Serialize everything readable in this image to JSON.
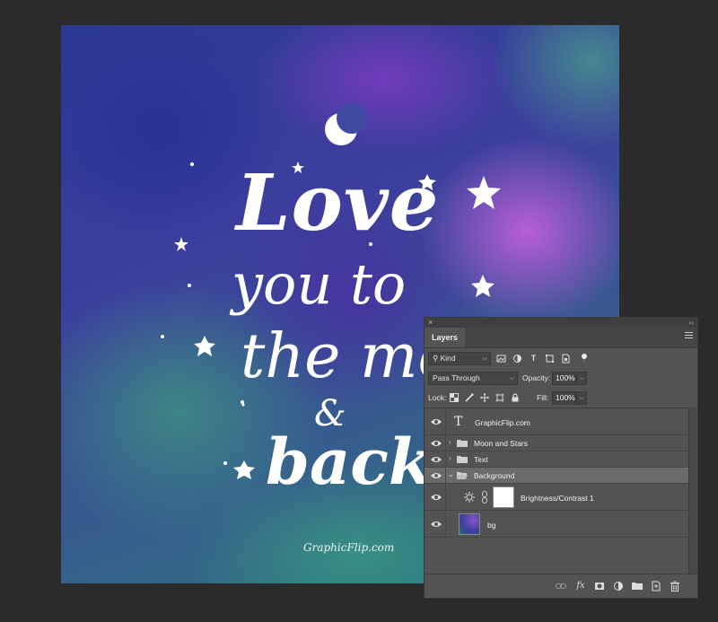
{
  "artwork": {
    "line1": "Love",
    "line2": "you to",
    "line3": "the moo",
    "line4": "&",
    "line5": "back",
    "signature": "GraphicFlip.com"
  },
  "panel": {
    "close_glyph": "×",
    "collapse_glyph": "‹‹",
    "tab_label": "Layers",
    "filter": {
      "kind_label": "Kind",
      "filter_icons": [
        "image-filter-icon",
        "adjustment-filter-icon",
        "type-filter-icon",
        "shape-filter-icon",
        "smart-object-filter-icon"
      ]
    },
    "blend_mode": "Pass Through",
    "opacity_label": "Opacity:",
    "opacity_value": "100%",
    "lock_label": "Lock:",
    "fill_label": "Fill:",
    "fill_value": "100%",
    "layers": [
      {
        "name": "GraphicFlip.com",
        "kind": "text"
      },
      {
        "name": "Moon and Stars",
        "kind": "group"
      },
      {
        "name": "Text",
        "kind": "group"
      },
      {
        "name": "Background",
        "kind": "group-open",
        "selected": true
      },
      {
        "name": "Brightness/Contrast 1",
        "kind": "adjustment"
      },
      {
        "name": "bg",
        "kind": "image"
      }
    ],
    "bottom_icons": [
      "link-layers-icon",
      "fx-icon",
      "add-mask-icon",
      "new-adjustment-icon",
      "new-group-icon",
      "new-layer-icon",
      "delete-layer-icon"
    ]
  },
  "colors": {
    "app_background": "#2b2b2b",
    "panel_background": "#535353",
    "selected_row": "#6a6a6a"
  }
}
